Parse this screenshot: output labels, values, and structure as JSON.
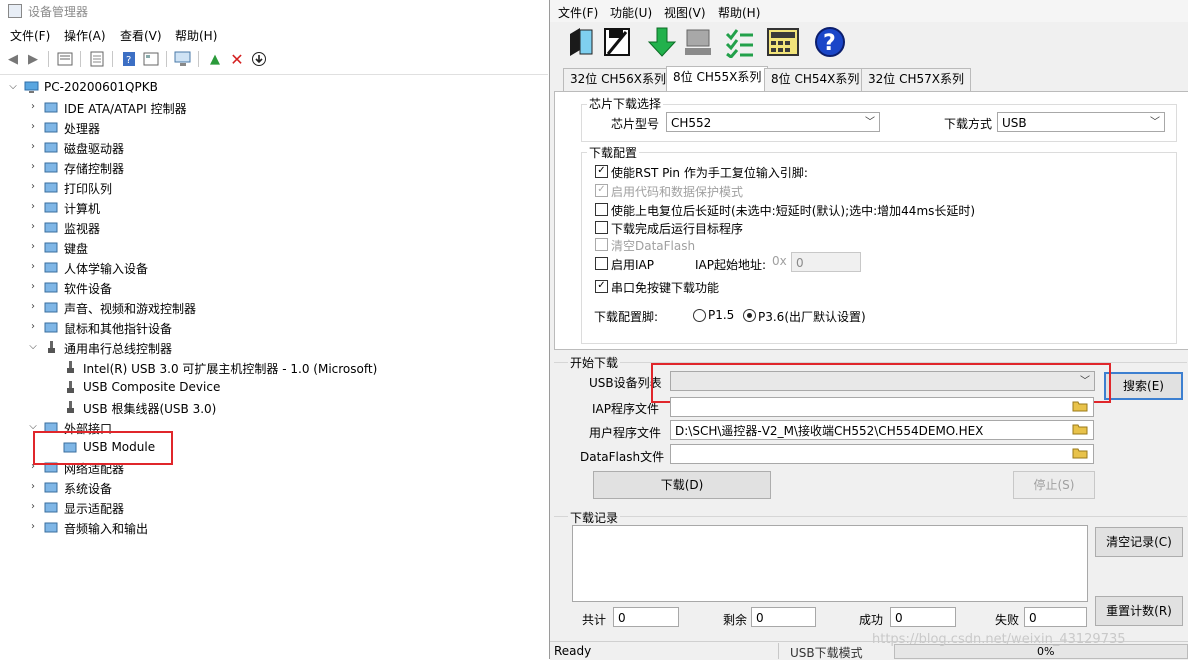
{
  "device_manager": {
    "title": "设备管理器",
    "menu": [
      "文件(F)",
      "操作(A)",
      "查看(V)",
      "帮助(H)"
    ],
    "computer": "PC-20200601QPKB",
    "categories": [
      {
        "label": "IDE ATA/ATAPI 控制器",
        "icon": "ide-controller-icon"
      },
      {
        "label": "处理器",
        "icon": "processor-icon"
      },
      {
        "label": "磁盘驱动器",
        "icon": "disk-drive-icon"
      },
      {
        "label": "存储控制器",
        "icon": "storage-controller-icon"
      },
      {
        "label": "打印队列",
        "icon": "printer-icon"
      },
      {
        "label": "计算机",
        "icon": "computer-icon"
      },
      {
        "label": "监视器",
        "icon": "monitor-icon"
      },
      {
        "label": "键盘",
        "icon": "keyboard-icon"
      },
      {
        "label": "人体学输入设备",
        "icon": "hid-icon"
      },
      {
        "label": "软件设备",
        "icon": "software-device-icon"
      },
      {
        "label": "声音、视频和游戏控制器",
        "icon": "sound-icon"
      },
      {
        "label": "鼠标和其他指针设备",
        "icon": "mouse-icon"
      },
      {
        "label": "通用串行总线控制器",
        "icon": "usb-icon"
      }
    ],
    "usb_children": [
      "Intel(R) USB 3.0 可扩展主机控制器 - 1.0 (Microsoft)",
      "USB Composite Device",
      "USB 根集线器(USB 3.0)"
    ],
    "external": "外部接口",
    "external_child": "USB Module",
    "more_categories": [
      {
        "label": "网络适配器",
        "icon": "network-adapter-icon"
      },
      {
        "label": "系统设备",
        "icon": "system-device-icon"
      },
      {
        "label": "显示适配器",
        "icon": "display-adapter-icon"
      },
      {
        "label": "音频输入和输出",
        "icon": "audio-io-icon"
      }
    ]
  },
  "wch": {
    "menu": [
      "文件(F)",
      "功能(U)",
      "视图(V)",
      "帮助(H)"
    ],
    "tabs": [
      "32位 CH56X系列",
      "8位 CH55X系列",
      "8位 CH54X系列",
      "32位 CH57X系列"
    ],
    "chip_group": "芯片下载选择",
    "chip_label": "芯片型号",
    "chip_value": "CH552",
    "mode_label": "下载方式",
    "mode_value": "USB",
    "config_group": "下载配置",
    "opt_rst": "使能RST Pin 作为手工复位输入引脚:",
    "opt_protect": "启用代码和数据保护模式",
    "opt_delay": "使能上电复位后长延时(未选中:短延时(默认);选中:增加44ms长延时)",
    "opt_run": "下载完成后运行目标程序",
    "opt_clear_df": "清空DataFlash",
    "opt_iap": "启用IAP",
    "iap_addr_label": "IAP起始地址:",
    "iap_prefix": "0x",
    "iap_addr_value": "0",
    "opt_serial": "串口免按键下载功能",
    "pin_label": "下载配置脚:",
    "pin_p15": "P1.5",
    "pin_p36": "P3.6(出厂默认设置)",
    "start_group": "开始下载",
    "usb_list_label": "USB设备列表",
    "usb_list_value": "",
    "search_btn": "搜索(E)",
    "iap_file_label": "IAP程序文件",
    "iap_file_value": "",
    "user_file_label": "用户程序文件",
    "user_file_value": "D:\\SCH\\遥控器-V2_M\\接收端CH552\\CH554DEMO.HEX",
    "df_file_label": "DataFlash文件",
    "df_file_value": "",
    "download_btn": "下载(D)",
    "stop_btn": "停止(S)",
    "log_group": "下载记录",
    "clear_log_btn": "清空记录(C)",
    "reset_count_btn": "重置计数(R)",
    "total_label": "共计",
    "total_value": "0",
    "remain_label": "剩余",
    "remain_value": "0",
    "success_label": "成功",
    "success_value": "0",
    "fail_label": "失败",
    "fail_value": "0",
    "status_ready": "Ready",
    "status_mode": "USB下载模式",
    "progress": "0%",
    "watermark": "https://blog.csdn.net/weixin_43129735"
  }
}
